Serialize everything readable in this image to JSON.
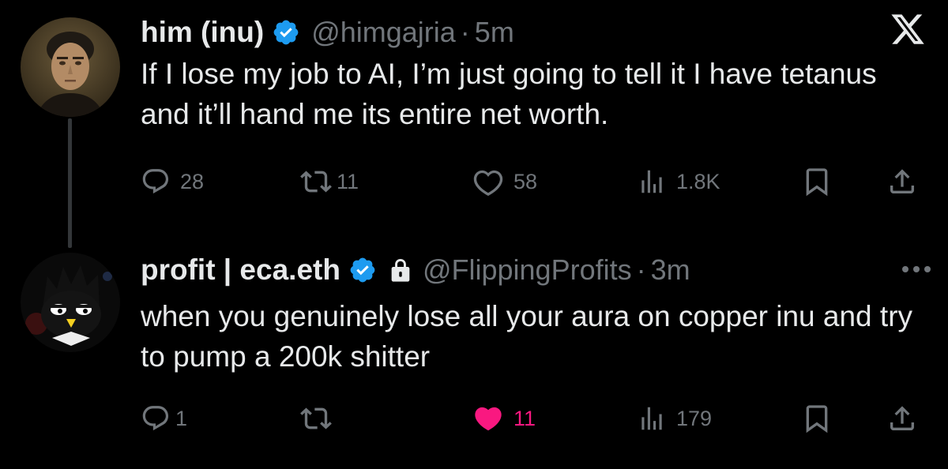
{
  "tweets": [
    {
      "author_name": "him (inu)",
      "handle": "@himgajria",
      "separator": "·",
      "time": "5m",
      "text": "If I lose my job to AI, I’m just going to tell it I have tetanus and it’ll hand me its entire net worth.",
      "replies": "28",
      "retweets": "11",
      "likes": "58",
      "views": "1.8K",
      "verified": true,
      "liked": false
    },
    {
      "author_name": "profit | eca.eth",
      "handle": "@FlippingProfits",
      "separator": "·",
      "time": "3m",
      "text": "when you genuinely lose all your aura on copper inu and try to pump a 200k shitter",
      "replies": "1",
      "retweets": "",
      "likes": "11",
      "views": "179",
      "verified": true,
      "protected": true,
      "liked": true
    }
  ],
  "colors": {
    "background": "#000000",
    "text": "#e7e9ea",
    "secondary": "#71767b",
    "verified": "#1d9bf0",
    "like_active": "#f91880"
  },
  "icons": {
    "header_right_1": "x-logo-icon",
    "header_right_2": "more-icon"
  }
}
